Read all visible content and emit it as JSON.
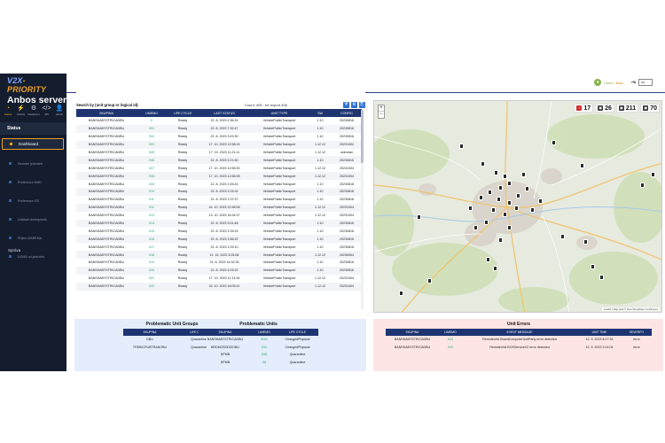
{
  "brand": {
    "logo_prefix": "V2X",
    "logo_suffix": "-PRIORITY",
    "title": "Anbos server"
  },
  "toolbar": [
    {
      "icon": "gauge-icon",
      "glyph": "◔",
      "label": "Status"
    },
    {
      "icon": "activity-icon",
      "glyph": "⚡",
      "label": "Activity"
    },
    {
      "icon": "gear-icon",
      "glyph": "⚙",
      "label": "Nastavení"
    },
    {
      "icon": "code-icon",
      "glyph": "</>",
      "label": "API"
    },
    {
      "icon": "user-icon",
      "glyph": "👤",
      "label": "admin"
    }
  ],
  "sidebar": {
    "status_section": "Status",
    "items": [
      {
        "label": "Dashboard",
        "active": true
      },
      {
        "label": "Seznam jednotek",
        "active": false
      },
      {
        "label": "Preference MHD",
        "active": false
      },
      {
        "label": "Preference IZS",
        "active": false
      },
      {
        "label": "Události dostupnosti",
        "active": false
      },
      {
        "label": "Příjem MAREMA",
        "active": false
      },
      {
        "label": "DOMA od jednotek",
        "active": false
      }
    ],
    "sprava_section": "Správa"
  },
  "header": {
    "user_name": "Users",
    "user_role": "Sea...",
    "lang": "cs"
  },
  "units": {
    "search_label": "Search by (unit group or logical id):",
    "count_text": "Count: 406 - for export 406",
    "columns": [
      "SKUPINA",
      "LIMEMO",
      "LIFE CYCLE",
      "LAST STATUS",
      "UNIT TYPE",
      "SW",
      "CONFIG"
    ],
    "rows": [
      [
        "BANSKABYSTRICADBU",
        "0",
        "Ready",
        "22. 8. 2023 2:36:24",
        "VehiclePublicTransport",
        "1.10",
        "20230816"
      ],
      [
        "BANSKABYSTRICADBU",
        "001",
        "Ready",
        "22. 8. 2023 7:32:47",
        "VehiclePublicTransport",
        "1.10",
        "20230816"
      ],
      [
        "BANSKABYSTRICADBU",
        "002",
        "Ready",
        "22. 8. 2023 3:23:30",
        "VehiclePublicTransport",
        "1.10",
        "20230816"
      ],
      [
        "BANSKABYSTRICADBU",
        "003",
        "Ready",
        "17. 10. 2023 12:58:24",
        "VehiclePublicTransport",
        "1.12.12",
        "20231004"
      ],
      [
        "BANSKABYSTRICADBU",
        "005",
        "Ready",
        "17. 10. 2023 11:21:11",
        "VehiclePublicTransport",
        "1.12.12",
        "unknown"
      ],
      [
        "BANSKABYSTRICADBU",
        "006",
        "Ready",
        "22. 8. 2023 2:21:50",
        "VehiclePublicTransport",
        "1.10",
        "20230816"
      ],
      [
        "BANSKABYSTRICADBU",
        "007",
        "Ready",
        "17. 10. 2023 12:55:33",
        "VehiclePublicTransport",
        "1.12.12",
        "20231004"
      ],
      [
        "BANSKABYSTRICADBU",
        "008",
        "Ready",
        "17. 10. 2023 12:58:28",
        "VehiclePublicTransport",
        "1.12.12",
        "20231004"
      ],
      [
        "BANSKABYSTRICADBU",
        "009",
        "Ready",
        "22. 8. 2023 2:25:24",
        "VehiclePublicTransport",
        "1.10",
        "20230816"
      ],
      [
        "BANSKABYSTRICADBU",
        "010",
        "Ready",
        "22. 8. 2023 2:24:32",
        "VehiclePublicTransport",
        "1.10",
        "20230816"
      ],
      [
        "BANSKABYSTRICADBU",
        "011",
        "Ready",
        "22. 8. 2023 2:37:37",
        "VehiclePublicTransport",
        "1.10",
        "20230816"
      ],
      [
        "BANSKABYSTRICADBU",
        "012",
        "Ready",
        "16. 10. 2023 22:58:08",
        "VehiclePublicTransport",
        "1.12.12",
        "20231004"
      ],
      [
        "BANSKABYSTRICADBU",
        "013",
        "Ready",
        "13. 10. 2023 16:34:37",
        "VehiclePublicTransport",
        "1.12.12",
        "20231004"
      ],
      [
        "BANSKABYSTRICADBU",
        "014",
        "Ready",
        "22. 8. 2023 3:01:48",
        "VehiclePublicTransport",
        "1.10",
        "20230816"
      ],
      [
        "BANSKABYSTRICADBU",
        "015",
        "Ready",
        "22. 8. 2023 2:25:29",
        "VehiclePublicTransport",
        "1.10",
        "20230816"
      ],
      [
        "BANSKABYSTRICADBU",
        "016",
        "Ready",
        "22. 8. 2023 2:56:22",
        "VehiclePublicTransport",
        "1.10",
        "20230816"
      ],
      [
        "BANSKABYSTRICADBU",
        "017",
        "Ready",
        "22. 8. 2023 2:29:10",
        "VehiclePublicTransport",
        "1.10",
        "20230816"
      ],
      [
        "BANSKABYSTRICADBU",
        "018",
        "Ready",
        "11. 10. 2023 3:25:08",
        "VehiclePublicTransport",
        "1.12.12",
        "20230904"
      ],
      [
        "BANSKABYSTRICADBU",
        "019",
        "Ready",
        "21. 8. 2023 14:32:35",
        "VehiclePublicTransport",
        "1.10",
        "20230816"
      ],
      [
        "BANSKABYSTRICADBU",
        "020",
        "Ready",
        "22. 8. 2023 4:03:22",
        "VehiclePublicTransport",
        "1.10",
        "20230816"
      ],
      [
        "BANSKABYSTRICADBU",
        "021",
        "Ready",
        "17. 10. 2023 11:13:34",
        "VehiclePublicTransport",
        "1.12.12",
        "20231004"
      ],
      [
        "BANSKABYSTRICADBU",
        "022",
        "Ready",
        "16. 10. 2023 16:05:41",
        "VehiclePublicTransport",
        "1.12.12",
        "20231004"
      ]
    ]
  },
  "map": {
    "zoom_in": "+",
    "zoom_out": "−",
    "stats": [
      {
        "icon": "alert-vehicle-icon",
        "glyph": "!",
        "value": "17",
        "red": true
      },
      {
        "icon": "bus-icon",
        "glyph": "▣",
        "value": "26",
        "red": false
      },
      {
        "icon": "bus-offline-icon",
        "glyph": "▣",
        "value": "211",
        "red": false
      },
      {
        "icon": "bus-total-icon",
        "glyph": "▣",
        "value": "70",
        "red": false
      }
    ],
    "attribution": "Leaflet | Map data © OpenStreetMap contributors"
  },
  "groups": {
    "title": "Problematic Unit Groups",
    "columns": [
      "SKUPINA",
      "LIFE CYCLE"
    ],
    "rows": [
      [
        "DBU",
        "Quarantine"
      ],
      [
        "TREBICPUBTRANOBU",
        "Quarantine"
      ]
    ]
  },
  "punits": {
    "title": "Problematic Units",
    "columns": [
      "SKUPINA",
      "LIMEMO",
      "LIFE CYCLE"
    ],
    "rows": [
      [
        "BANSKABYSTRICADBU",
        "3101",
        "ChangedPhysical"
      ],
      [
        "BRDMCBODZIOBU",
        "031",
        "ChangedPhysical"
      ],
      [
        "DPMB",
        "035",
        "Quarantine"
      ],
      [
        "DPMB",
        "08",
        "Quarantine"
      ]
    ]
  },
  "errors": {
    "title": "Unit Errors",
    "columns": [
      "SKUPINA",
      "LIMEMO",
      "EVENT MESSAGE",
      "UNIT TIME",
      "SEVERITY"
    ],
    "rows": [
      [
        "BANSKABYSTRICADBU",
        "024",
        "RemoteUnit BoardComputerUnitParty error detected",
        "12. 9. 2023 8:17:33",
        "error"
      ],
      [
        "BANSKABYSTRICADBU",
        "041",
        "RemoteUnit BOSServiceV2 error detected",
        "12. 9. 2023 9:14:04",
        "error"
      ]
    ]
  }
}
